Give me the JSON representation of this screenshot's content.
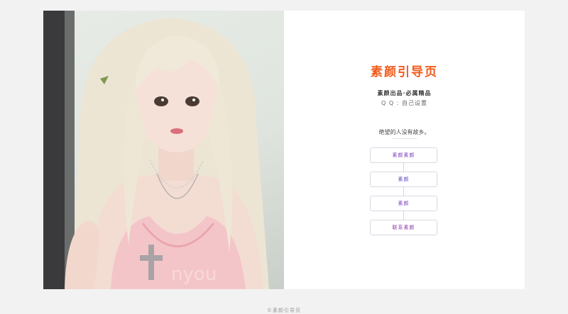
{
  "hero": {
    "watermark": "nyou",
    "accent_colors": {
      "hair": "#efe8d8",
      "skin": "#f4ddd4",
      "dress": "#f2c7c9"
    }
  },
  "panel": {
    "title": "素颜引导页",
    "subtitle": "素颜出品·必属精品",
    "qq": "Q Q : 自己设置",
    "motto": "绝望的人没有故乡。",
    "links": [
      {
        "label": "素颜素颜"
      },
      {
        "label": "素颜"
      },
      {
        "label": "素颜"
      },
      {
        "label": "联系素颜"
      }
    ]
  },
  "colors": {
    "title": "#f05a1a",
    "link": "#7b3dbf",
    "background": "#f2f2f2"
  },
  "footer": {
    "text": "©素颜引导页"
  }
}
